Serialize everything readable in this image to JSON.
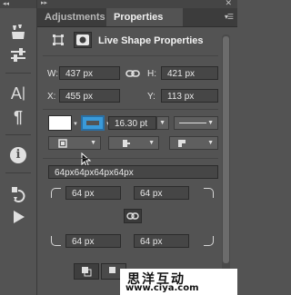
{
  "toolbar": {
    "collapse_glyph": "◂◂",
    "items": [
      "adjustments-icon",
      "properties-icon",
      "character-icon",
      "paragraph-icon",
      "info-icon",
      "history-icon",
      "actions-icon"
    ],
    "char_glyph": "A",
    "para_glyph": "¶",
    "info_glyph": "i"
  },
  "panel": {
    "collapse_glyph": "▸▸",
    "close_glyph": "✕",
    "tabs": [
      {
        "label": "Adjustments"
      },
      {
        "label": "Properties"
      }
    ],
    "title": "Live Shape Properties",
    "transform": {
      "w_label": "W:",
      "w_value": "437 px",
      "h_label": "H:",
      "h_value": "421 px",
      "x_label": "X:",
      "x_value": "455 px",
      "y_label": "Y:",
      "y_value": "113 px"
    },
    "stroke": {
      "fill_color": "#ffffff",
      "stroke_color": "#3a9ad9",
      "stroke_width": "16.30 pt"
    },
    "corners": {
      "combined": "64px64px64px64px",
      "top_left": "64 px",
      "top_right": "64 px",
      "bottom_left": "64 px",
      "bottom_right": "64 px"
    }
  },
  "watermark": {
    "line1": "思洋互动",
    "line2": "www.ciya.com"
  }
}
